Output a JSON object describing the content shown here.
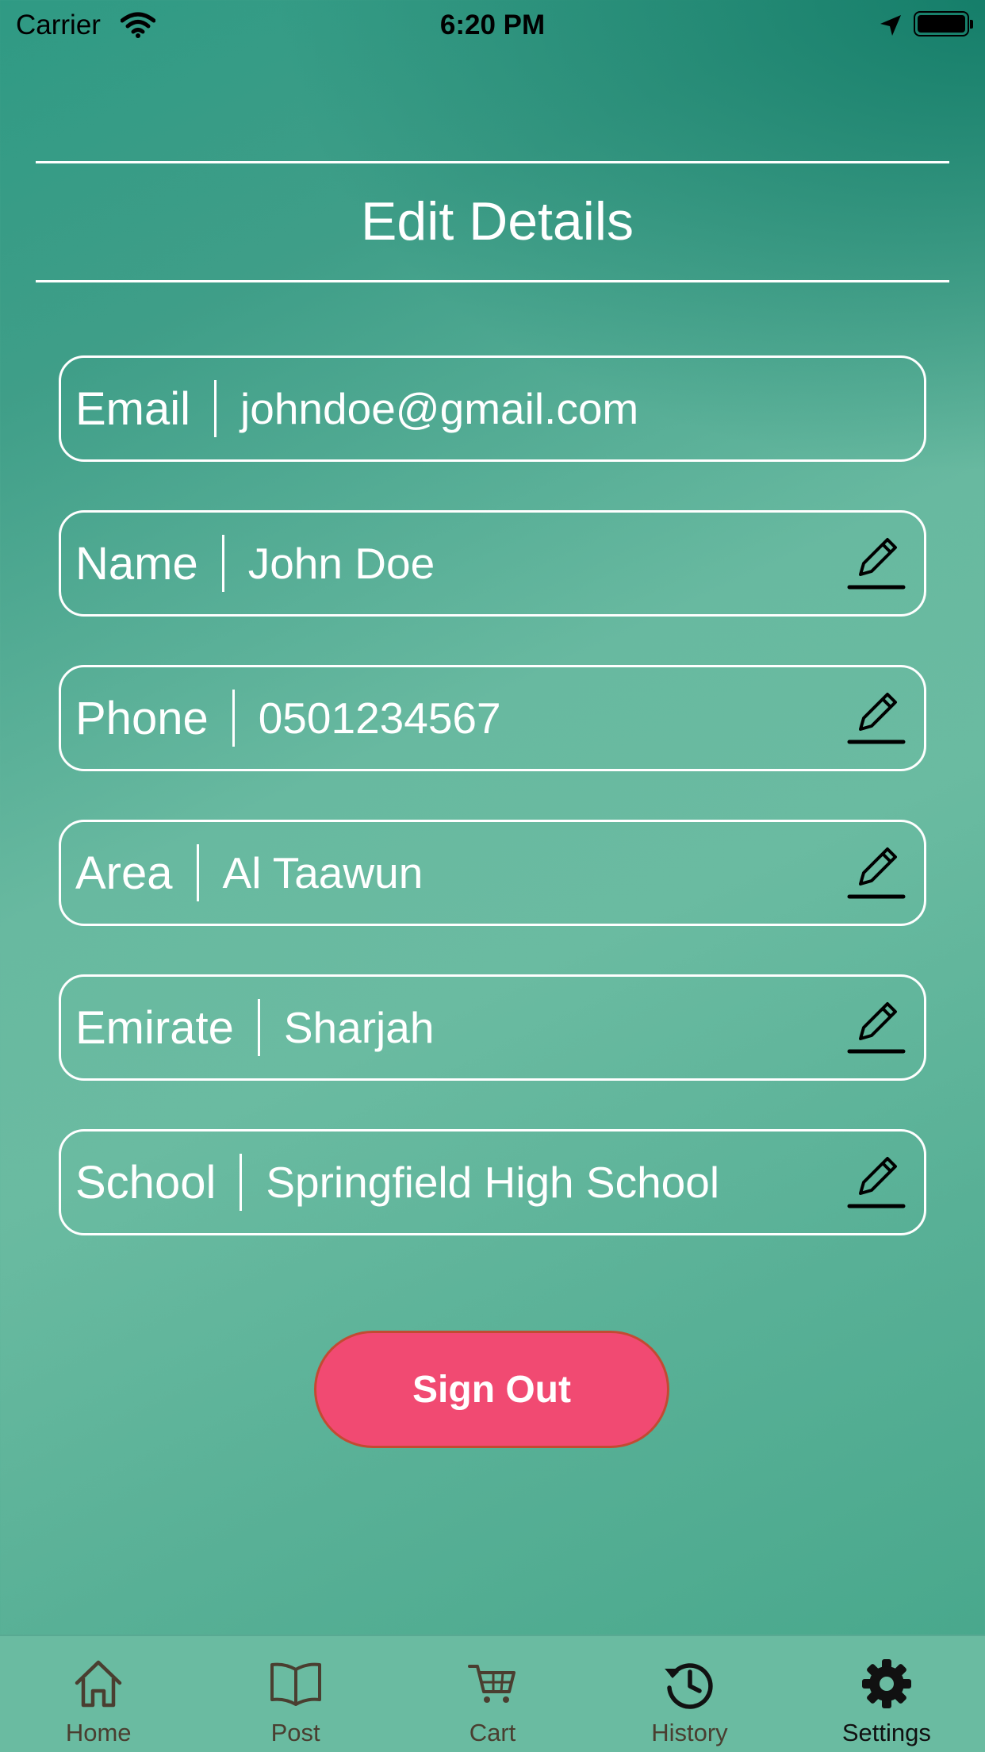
{
  "status_bar": {
    "carrier": "Carrier",
    "time": "6:20 PM"
  },
  "page": {
    "title": "Edit Details"
  },
  "fields": [
    {
      "label": "Email",
      "value": "johndoe@gmail.com",
      "editable": false
    },
    {
      "label": "Name",
      "value": "John Doe",
      "editable": true
    },
    {
      "label": "Phone",
      "value": "0501234567",
      "editable": true
    },
    {
      "label": "Area",
      "value": "Al Taawun",
      "editable": true
    },
    {
      "label": "Emirate",
      "value": "Sharjah",
      "editable": true
    },
    {
      "label": "School",
      "value": "Springfield High School",
      "editable": true
    }
  ],
  "actions": {
    "sign_out_label": "Sign Out"
  },
  "tabbar": {
    "tabs": [
      {
        "label": "Home",
        "icon": "home-icon"
      },
      {
        "label": "Post",
        "icon": "book-icon"
      },
      {
        "label": "Cart",
        "icon": "cart-icon"
      },
      {
        "label": "History",
        "icon": "history-icon"
      },
      {
        "label": "Settings",
        "icon": "gear-icon",
        "active": true
      }
    ]
  },
  "colors": {
    "accent": "#f14a72",
    "background_top": "#1a8570",
    "background_mid": "#6abba1",
    "text": "#ffffff"
  }
}
